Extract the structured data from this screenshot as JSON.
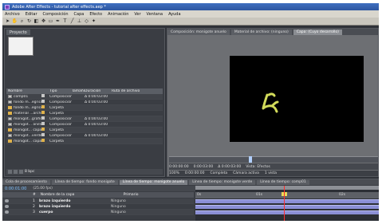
{
  "window": {
    "title": "Adobe After Effects - tutorial after effects.aep *"
  },
  "menu": [
    "Archivo",
    "Editar",
    "Composición",
    "Capa",
    "Efecto",
    "Animación",
    "Ver",
    "Ventana",
    "Ayuda"
  ],
  "toolbar": {
    "tools": [
      "selection-tool",
      "hand-tool",
      "zoom-tool",
      "rotate-tool",
      "camera-tool",
      "pan-behind-tool",
      "rectangle-tool",
      "pen-tool",
      "text-tool",
      "brush-tool",
      "clone-tool",
      "eraser-tool",
      "puppet-tool"
    ]
  },
  "project": {
    "tab": "Proyecto",
    "columns": [
      "Nombre",
      "Tipo",
      "Tamaño",
      "Duración",
      "Ruta de archivo"
    ],
    "items": [
      {
        "name": "comp01",
        "type": "Composición",
        "size": "",
        "duration": "Δ 0:00:03:00",
        "icon": "comp",
        "label_color": "#c7c7c7"
      },
      {
        "name": "fondo m...egrico",
        "type": "Composición",
        "size": "",
        "duration": "Δ 0:00:03:00",
        "icon": "comp",
        "label_color": "#c7c7c7"
      },
      {
        "name": "fondo m...egrico",
        "type": "Carpeta",
        "size": "",
        "duration": "",
        "icon": "folder",
        "label_color": "#e0b24a"
      },
      {
        "name": "material ...archivo",
        "type": "Carpeta",
        "size": "",
        "duration": "",
        "icon": "folder",
        "label_color": "#e0b24a"
      },
      {
        "name": "monigot...grafica",
        "type": "Composición",
        "size": "",
        "duration": "Δ 0:00:03:00",
        "icon": "comp",
        "label_color": "#c7c7c7"
      },
      {
        "name": "monigot... anillo",
        "type": "Composición",
        "size": "",
        "duration": "Δ 0:00:03:00",
        "icon": "comp",
        "label_color": "#c7c7c7"
      },
      {
        "name": "monigot... capas",
        "type": "Carpeta",
        "size": "",
        "duration": "",
        "icon": "folder",
        "label_color": "#e0b24a"
      },
      {
        "name": "monigot...verde",
        "type": "Composición",
        "size": "",
        "duration": "Δ 0:00:03:00",
        "icon": "comp",
        "label_color": "#c7c7c7"
      },
      {
        "name": "monigot... capas",
        "type": "Carpeta",
        "size": "",
        "duration": "",
        "icon": "folder",
        "label_color": "#e0b24a"
      }
    ],
    "footer": "8 bpc"
  },
  "viewer": {
    "tabs": [
      "Composición: monigote anuelo",
      "Material de archivo: (ninguno)",
      "Capa: (Cuyo desarrollo)"
    ],
    "active_tab_index": 2,
    "controls": [
      "0:00:00:00",
      "0:00:03:00",
      "Δ 0:00:03:00",
      "Vista: Efectos"
    ],
    "controls2": [
      "100%",
      "0:00:00:00",
      "Completa",
      "Cámara activa",
      "1 vista"
    ]
  },
  "timeline": {
    "tabs": [
      "Cola de procesamiento",
      "Línea de tiempo: fondo monigote",
      "Línea de tiempo: monigote anuelo",
      "Línea de tiempo: monigote verde",
      "Línea de tiempo: comp01"
    ],
    "active_tab_index": 2,
    "timecode": "0:00:01:00",
    "search_label": "(25.00 fps)",
    "columns": [
      "#",
      "Nombre de la capa",
      "Primario"
    ],
    "layers": [
      {
        "num": "1",
        "name": "brazo izquierdo",
        "parent": "Ninguno"
      },
      {
        "num": "2",
        "name": "brazo izquierdo",
        "parent": "Ninguno"
      },
      {
        "num": "3",
        "name": "cuerpo",
        "parent": "Ninguno"
      }
    ],
    "ruler_ticks": [
      "0s",
      "01s",
      "02s"
    ],
    "playhead_time": "0:00:01:00"
  },
  "colors": {
    "canvas": "#000000",
    "shape": "#d2db5a",
    "timecode": "#7ec1ff",
    "layer_bar": "#8b8fd6",
    "playhead": "#ff2d2d"
  }
}
